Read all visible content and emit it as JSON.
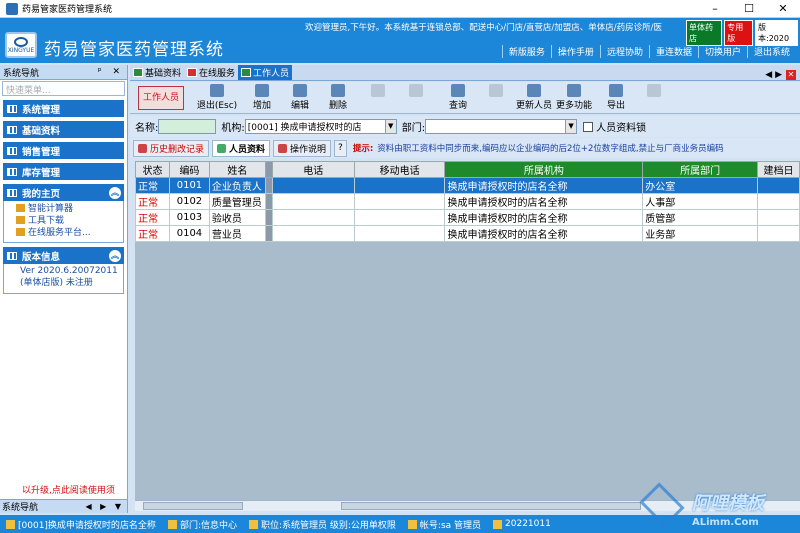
{
  "window": {
    "title": "药易管家医药管理系统",
    "btn_min": "–",
    "btn_max": "☐",
    "btn_close": "✕"
  },
  "header": {
    "logo_text": "XINGYUE",
    "system_name": "药易管家医药管理系统",
    "marquee": "欢迎管理员,下午好。本系统基于连锁总部、配送中心/门店/直营店/加盟店、单体店/药房诊所/医",
    "badge_single": "单体药店",
    "badge_stock": "专用版",
    "badge_version": "版本:2020",
    "links": [
      "新版服务",
      "操作手册",
      "远程协助",
      "重连数据",
      "切换用户",
      "退出系统"
    ]
  },
  "left_panel": {
    "title": "系统导航",
    "pin": "ᵖ ✕",
    "search_placeholder": "快速菜单...",
    "menus": [
      "系统管理",
      "基础资料",
      "销售管理",
      "库存管理"
    ],
    "home_title": "我的主页",
    "home_items": [
      "智能计算器",
      "工具下载",
      "在线服务平台..."
    ],
    "version_title": "版本信息",
    "version_line1": "Ver 2020.6.20072011",
    "version_line2": "(单体店版) 未注册",
    "note": "以升级,点此阅读使用须",
    "bottom_label": "系统导航",
    "bottom_arrows": "◀ ▶ ▼"
  },
  "tabs": [
    "基础资料",
    "在线服务",
    "工作人员"
  ],
  "tab_controls": "◀ ▶",
  "tab_close": "✕",
  "toolbar": {
    "main": "工作人员",
    "buttons": [
      "退出(Esc)",
      "增加",
      "编辑",
      "删除",
      "",
      "",
      "查询",
      "",
      "更新人员",
      "更多功能",
      "导出",
      ""
    ]
  },
  "filter": {
    "name_label": "名称:",
    "name_value": "",
    "org_label": "机构:",
    "org_value": "[0001] 换成申请授权时的店",
    "dept_label": "部门:",
    "dept_value": "",
    "lock_label": "人员资料锁"
  },
  "subtabs": [
    "历史删改记录",
    "人员资料",
    "操作说明"
  ],
  "hint": {
    "label": "提示:",
    "text": "资料由职工资料中同步而来,编码应以企业编码的后2位+2位数字组成,禁止与厂商业务员编码"
  },
  "table": {
    "columns": [
      "状态",
      "编码",
      "姓名",
      "电话",
      "移动电话",
      "所属机构",
      "所属部门",
      "建档日"
    ],
    "rows": [
      {
        "status": "正常",
        "code": "0101",
        "name": "企业负责人",
        "phone": "",
        "mobile": "",
        "org": "换成申请授权时的店名全称",
        "dept": "办公室",
        "date": ""
      },
      {
        "status": "正常",
        "code": "0102",
        "name": "质量管理员",
        "phone": "",
        "mobile": "",
        "org": "换成申请授权时的店名全称",
        "dept": "人事部",
        "date": ""
      },
      {
        "status": "正常",
        "code": "0103",
        "name": "验收员",
        "phone": "",
        "mobile": "",
        "org": "换成申请授权时的店名全称",
        "dept": "质管部",
        "date": ""
      },
      {
        "status": "正常",
        "code": "0104",
        "name": "营业员",
        "phone": "",
        "mobile": "",
        "org": "换成申请授权时的店名全称",
        "dept": "业务部",
        "date": ""
      }
    ]
  },
  "statusbar": {
    "store": "[0001]换成申请授权时的店名全称",
    "dept": "部门:信息中心",
    "role": "职位:系统管理员 级别:公用单权限",
    "account": "帐号:sa 管理员",
    "date": "20221011"
  },
  "watermark": {
    "text": "阿哩模板",
    "url": "ALimm.Com"
  }
}
